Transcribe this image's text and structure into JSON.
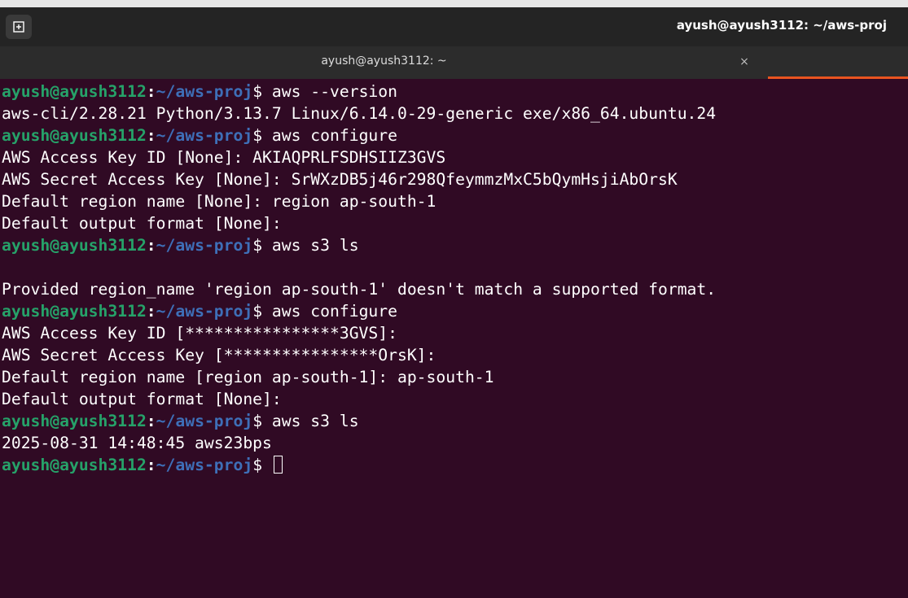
{
  "window": {
    "title": "ayush@ayush3112: ~/aws-proj"
  },
  "tabs": [
    {
      "label": "ayush@ayush3112: ~",
      "close_glyph": "×"
    }
  ],
  "prompt": {
    "user_host": "ayush@ayush3112",
    "colon": ":",
    "path": "~/aws-proj",
    "symbol": "$"
  },
  "terminal": {
    "lines": [
      {
        "type": "command",
        "text": " aws --version"
      },
      {
        "type": "output",
        "text": "aws-cli/2.28.21 Python/3.13.7 Linux/6.14.0-29-generic exe/x86_64.ubuntu.24"
      },
      {
        "type": "command",
        "text": " aws configure"
      },
      {
        "type": "output",
        "text": "AWS Access Key ID [None]: AKIAQPRLFSDHSIIZ3GVS"
      },
      {
        "type": "output",
        "text": "AWS Secret Access Key [None]: SrWXzDB5j46r298QfeymmzMxC5bQymHsjiAbOrsK"
      },
      {
        "type": "output",
        "text": "Default region name [None]: region ap-south-1"
      },
      {
        "type": "output",
        "text": "Default output format [None]:"
      },
      {
        "type": "command",
        "text": " aws s3 ls"
      },
      {
        "type": "output",
        "text": ""
      },
      {
        "type": "output",
        "text": "Provided region_name 'region ap-south-1' doesn't match a supported format."
      },
      {
        "type": "command",
        "text": " aws configure"
      },
      {
        "type": "output",
        "text": "AWS Access Key ID [****************3GVS]:"
      },
      {
        "type": "output",
        "text": "AWS Secret Access Key [****************OrsK]:"
      },
      {
        "type": "output",
        "text": "Default region name [region ap-south-1]: ap-south-1"
      },
      {
        "type": "output",
        "text": "Default output format [None]:"
      },
      {
        "type": "command",
        "text": " aws s3 ls"
      },
      {
        "type": "output",
        "text": "2025-08-31 14:48:45 aws23bps"
      },
      {
        "type": "command",
        "text": " "
      }
    ]
  },
  "colors": {
    "background": "#300a24",
    "prompt_user": "#26a269",
    "prompt_path": "#3e6fb8",
    "active_tab_indicator": "#e95420"
  },
  "icons": {
    "new_tab": "new-tab-icon",
    "close": "close-icon"
  }
}
